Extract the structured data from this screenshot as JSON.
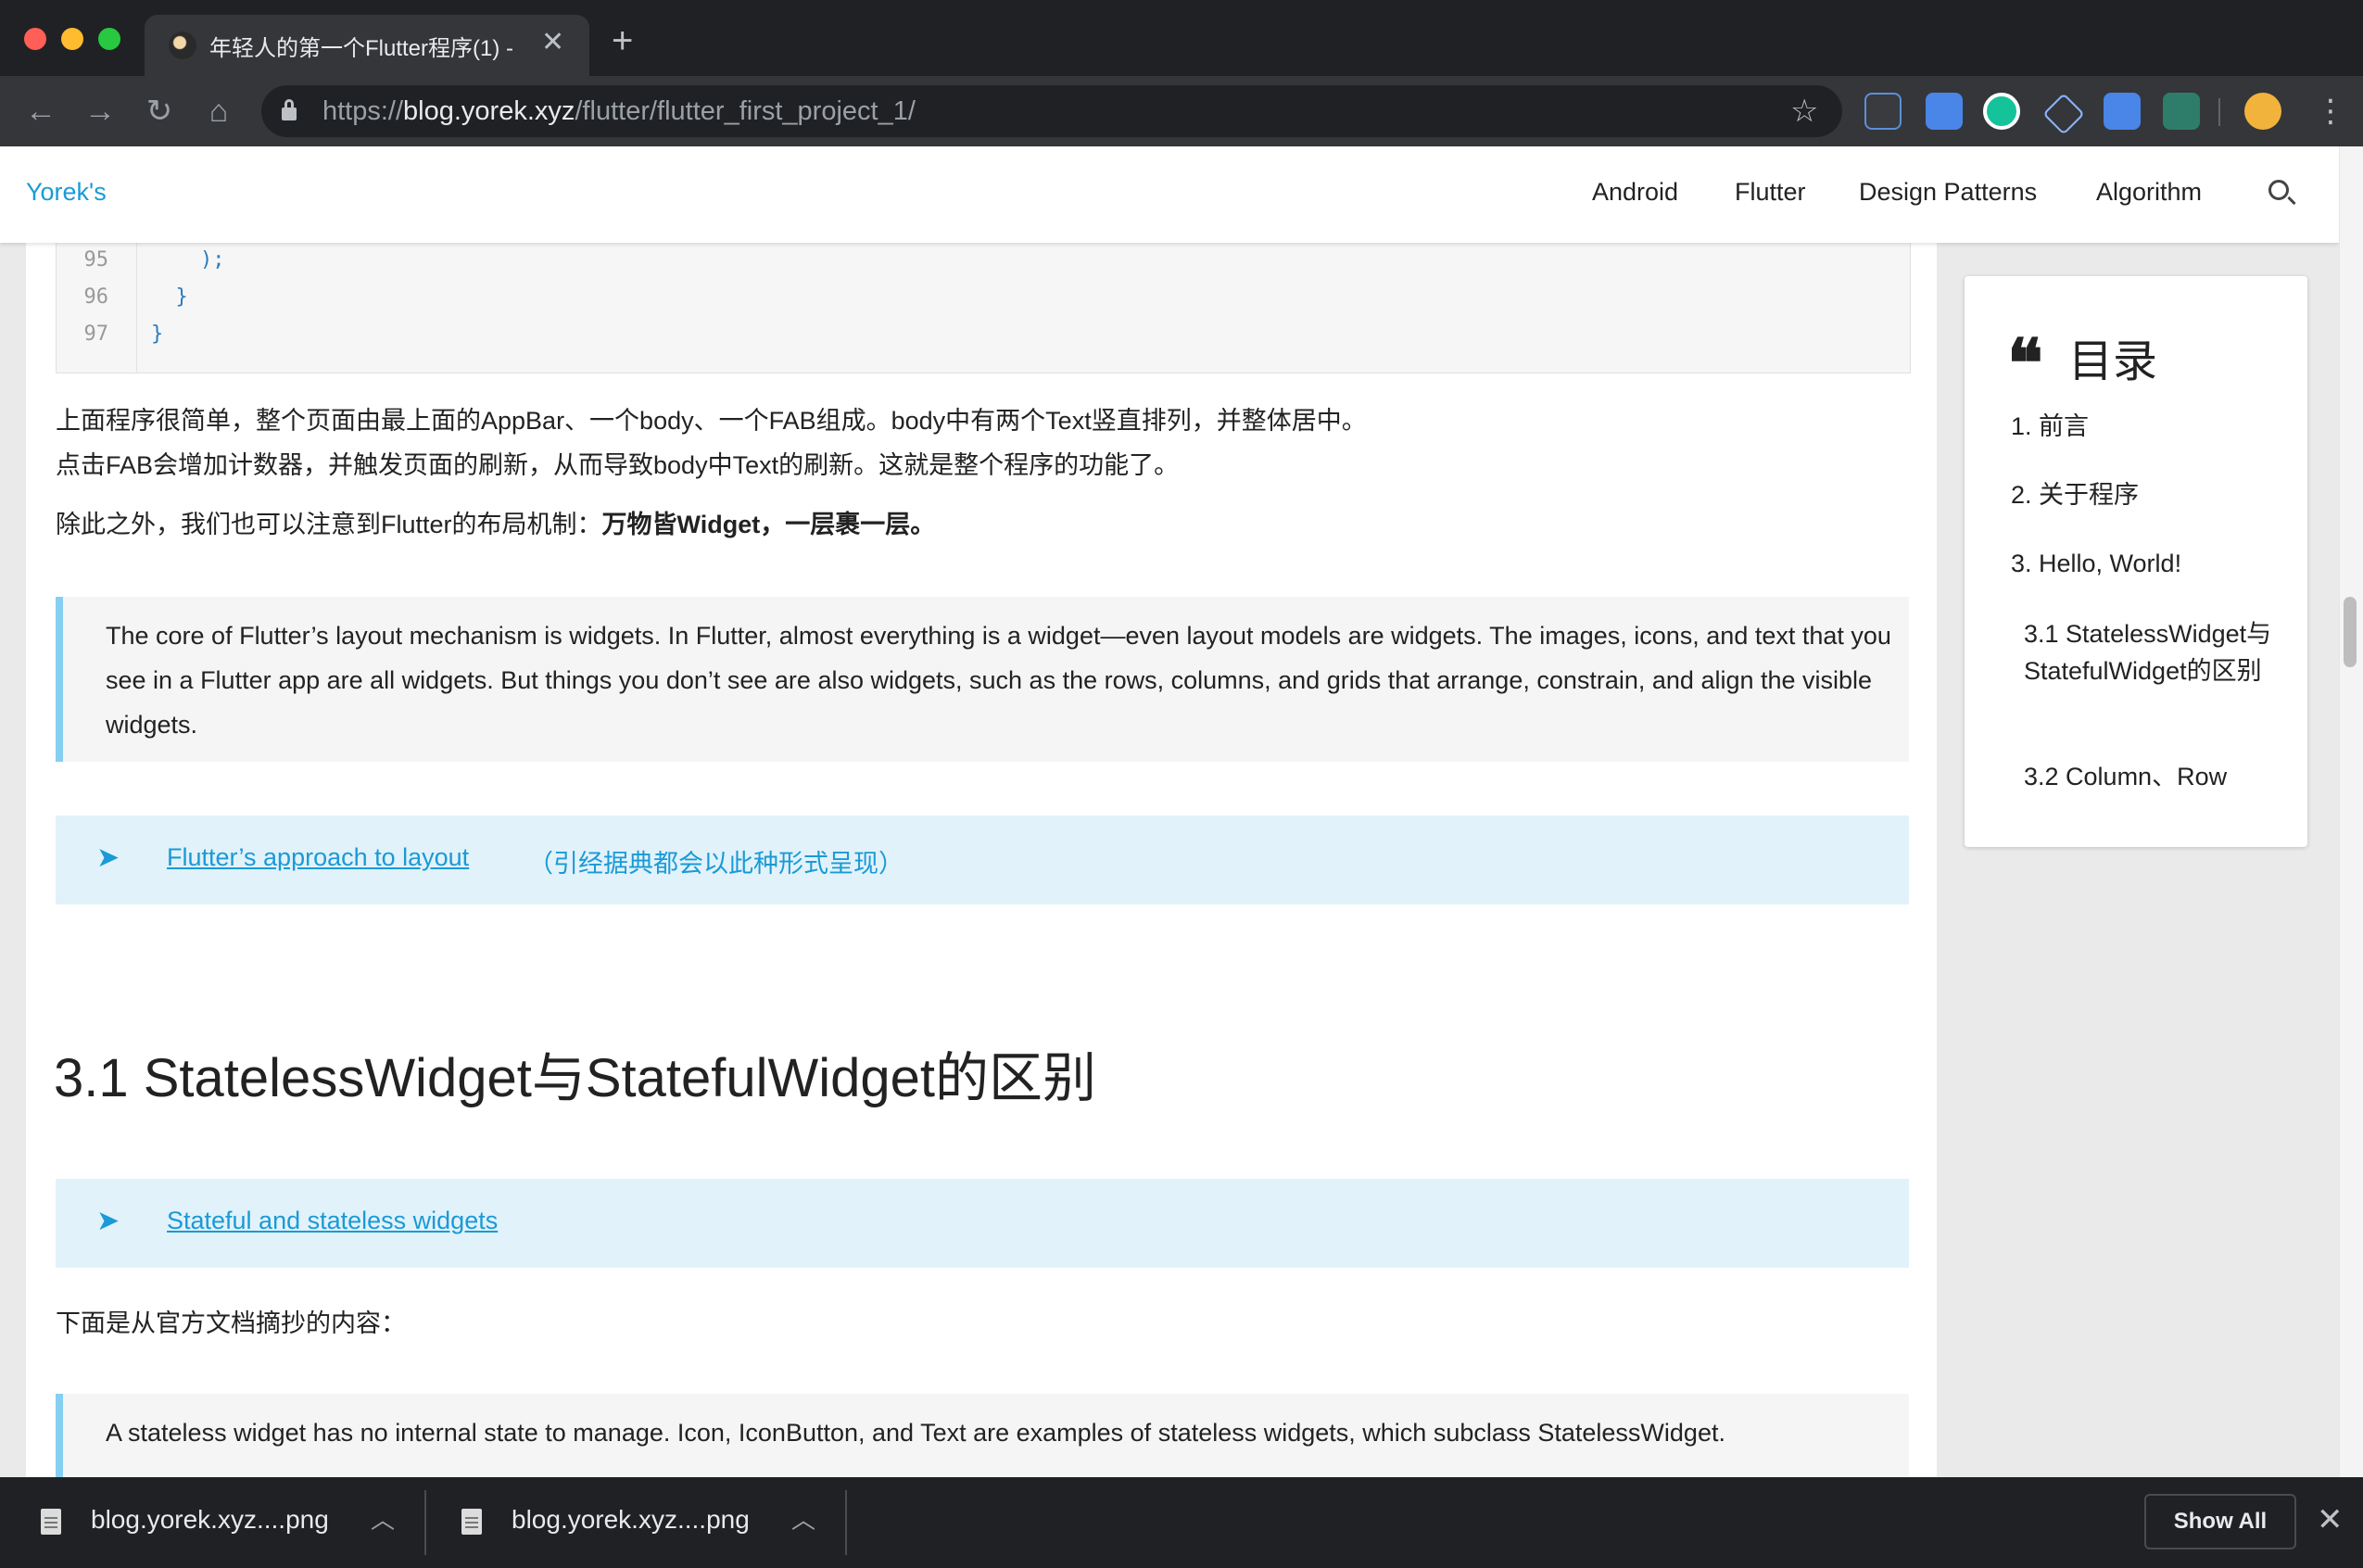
{
  "browser": {
    "tab_title": "年轻人的第一个Flutter程序(1) - ",
    "url_scheme": "https://",
    "url_host": "blog.yorek.xyz",
    "url_path": "/flutter/flutter_first_project_1/",
    "traffic_colors": [
      "#ff5f57",
      "#febc2e",
      "#28c840"
    ]
  },
  "site": {
    "brand": "Yorek's",
    "nav": [
      "Android",
      "Flutter",
      "Design Patterns",
      "Algorithm"
    ]
  },
  "code": {
    "lines": [
      {
        "n": "95",
        "text": "    );"
      },
      {
        "n": "96",
        "text": "  }"
      },
      {
        "n": "97",
        "text": "}"
      }
    ]
  },
  "article": {
    "p1_line1": "上面程序很简单，整个页面由最上面的AppBar、一个body、一个FAB组成。body中有两个Text竖直排列，并整体居中。",
    "p1_line2": "点击FAB会增加计数器，并触发页面的刷新，从而导致body中Text的刷新。这就是整个程序的功能了。",
    "p2_prefix": "除此之外，我们也可以注意到Flutter的布局机制：",
    "p2_bold": "万物皆Widget，一层裹一层。",
    "quote1": "The core of Flutter’s layout mechanism is widgets. In Flutter, almost everything is a widget—even layout models are widgets. The images, icons, and text that you see in a Flutter app are all widgets. But things you don’t see are also widgets, such as the rows, columns, and grids that arrange, constrain, and align the visible widgets.",
    "ref1_link": "Flutter’s approach to layout",
    "ref1_note": "（引经据典都会以此种形式呈现）",
    "heading": "3.1 StatelessWidget与StatefulWidget的区别",
    "ref2_link": "Stateful and stateless widgets",
    "p3": "下面是从官方文档摘抄的内容：",
    "quote2": "A stateless widget has no internal state to manage. Icon, IconButton, and Text are examples of stateless widgets, which subclass StatelessWidget."
  },
  "toc": {
    "title": "目录",
    "items": [
      {
        "label": "1. 前言"
      },
      {
        "label": "2. 关于程序"
      },
      {
        "label": "3. Hello, World!"
      },
      {
        "label": "3.1 StatelessWidget与StatefulWidget的区别"
      },
      {
        "label": "3.2 Column、Row"
      }
    ]
  },
  "downloads": {
    "items": [
      "blog.yorek.xyz....png",
      "blog.yorek.xyz....png"
    ],
    "show_all": "Show All"
  },
  "colors": {
    "accent": "#1a9ad6",
    "quote_border": "#86cff0",
    "ref_background": "#e1f2fb"
  }
}
